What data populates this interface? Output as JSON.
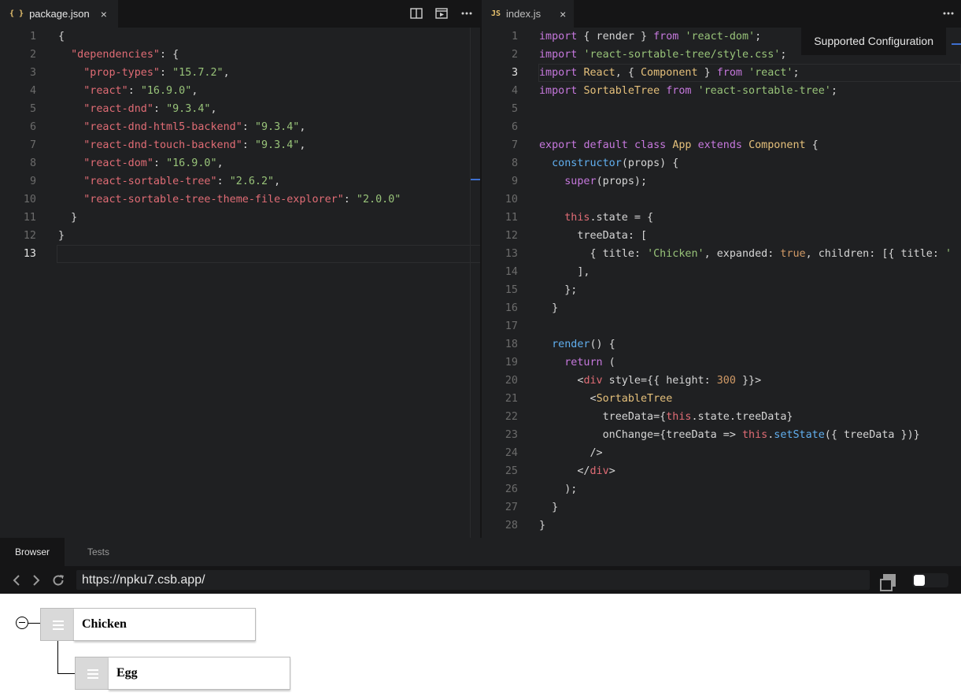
{
  "left_tab": {
    "icon": "{ }",
    "title": "package.json",
    "close": "×",
    "icon_color": "#e8c26e"
  },
  "right_tab": {
    "icon": "JS",
    "title": "index.js",
    "close": "×",
    "icon_color": "#e8c26e"
  },
  "tooltip": "Supported Configuration",
  "left_code": [
    {
      "n": "1",
      "t": "{"
    },
    {
      "n": "2",
      "t": "  \"dependencies\": {"
    },
    {
      "n": "3",
      "t": "    \"prop-types\": \"15.7.2\","
    },
    {
      "n": "4",
      "t": "    \"react\": \"16.9.0\","
    },
    {
      "n": "5",
      "t": "    \"react-dnd\": \"9.3.4\","
    },
    {
      "n": "6",
      "t": "    \"react-dnd-html5-backend\": \"9.3.4\","
    },
    {
      "n": "7",
      "t": "    \"react-dnd-touch-backend\": \"9.3.4\","
    },
    {
      "n": "8",
      "t": "    \"react-dom\": \"16.9.0\","
    },
    {
      "n": "9",
      "t": "    \"react-sortable-tree\": \"2.6.2\","
    },
    {
      "n": "10",
      "t": "    \"react-sortable-tree-theme-file-explorer\": \"2.0.0\""
    },
    {
      "n": "11",
      "t": "  }"
    },
    {
      "n": "12",
      "t": "}"
    },
    {
      "n": "13",
      "t": ""
    }
  ],
  "right_code": [
    {
      "n": "1",
      "t": "import { render } from 'react-dom';"
    },
    {
      "n": "2",
      "t": "import 'react-sortable-tree/style.css';"
    },
    {
      "n": "3",
      "t": "import React, { Component } from 'react';"
    },
    {
      "n": "4",
      "t": "import SortableTree from 'react-sortable-tree';"
    },
    {
      "n": "5",
      "t": ""
    },
    {
      "n": "6",
      "t": ""
    },
    {
      "n": "7",
      "t": "export default class App extends Component {"
    },
    {
      "n": "8",
      "t": "  constructor(props) {"
    },
    {
      "n": "9",
      "t": "    super(props);"
    },
    {
      "n": "10",
      "t": ""
    },
    {
      "n": "11",
      "t": "    this.state = {"
    },
    {
      "n": "12",
      "t": "      treeData: ["
    },
    {
      "n": "13",
      "t": "        { title: 'Chicken', expanded: true, children: [{ title: '"
    },
    {
      "n": "14",
      "t": "      ],"
    },
    {
      "n": "15",
      "t": "    };"
    },
    {
      "n": "16",
      "t": "  }"
    },
    {
      "n": "17",
      "t": ""
    },
    {
      "n": "18",
      "t": "  render() {"
    },
    {
      "n": "19",
      "t": "    return ("
    },
    {
      "n": "20",
      "t": "      <div style={{ height: 300 }}>"
    },
    {
      "n": "21",
      "t": "        <SortableTree"
    },
    {
      "n": "22",
      "t": "          treeData={this.state.treeData}"
    },
    {
      "n": "23",
      "t": "          onChange={treeData => this.setState({ treeData })}"
    },
    {
      "n": "24",
      "t": "        />"
    },
    {
      "n": "25",
      "t": "      </div>"
    },
    {
      "n": "26",
      "t": "    );"
    },
    {
      "n": "27",
      "t": "  }"
    },
    {
      "n": "28",
      "t": "}"
    }
  ],
  "bottom": {
    "tabs": [
      "Browser",
      "Tests"
    ],
    "url": "https://npku7.csb.app/"
  },
  "tree": [
    {
      "title": "Chicken"
    },
    {
      "title": "Egg"
    }
  ],
  "colors": {
    "keyword": "#c678dd",
    "string": "#98c379",
    "property": "#e06c75",
    "type": "#e5c07b",
    "function": "#61afef"
  }
}
